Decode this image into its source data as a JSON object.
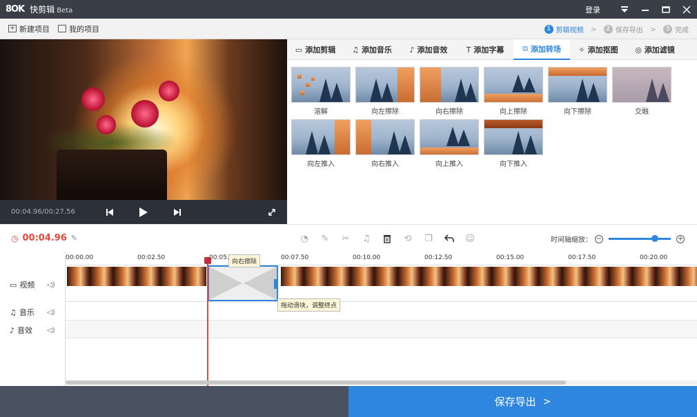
{
  "window": {
    "logo": "8OK",
    "app_name": "快剪辑",
    "beta": "Beta",
    "login": "登录",
    "icons": [
      "menu-icon",
      "minimize-icon",
      "maximize-icon",
      "close-icon"
    ]
  },
  "toolbar": {
    "new_project": "新建项目",
    "my_projects": "我的项目",
    "steps": [
      {
        "num": "1",
        "label": "剪辑视频"
      },
      {
        "num": "2",
        "label": "保存导出"
      },
      {
        "num": "3",
        "label": "完成"
      }
    ],
    "active_step": 0
  },
  "preview": {
    "timecode": "00:04.96/00:27.56",
    "icons": [
      "prev-frame-icon",
      "play-icon",
      "next-frame-icon",
      "fullscreen-icon"
    ]
  },
  "tabs": [
    {
      "label": "添加剪辑",
      "icon": "video-icon"
    },
    {
      "label": "添加音乐",
      "icon": "music-icon"
    },
    {
      "label": "添加音效",
      "icon": "sound-effect-icon"
    },
    {
      "label": "添加字幕",
      "icon": "text-icon"
    },
    {
      "label": "添加转场",
      "icon": "transition-icon"
    },
    {
      "label": "添加抠图",
      "icon": "cutout-icon"
    },
    {
      "label": "添加滤镜",
      "icon": "filter-icon"
    }
  ],
  "active_tab": 4,
  "transitions": [
    {
      "label": "溶解"
    },
    {
      "label": "向左擦除"
    },
    {
      "label": "向右擦除"
    },
    {
      "label": "向上擦除"
    },
    {
      "label": "向下擦除"
    },
    {
      "label": "交融"
    },
    {
      "label": "向左推入"
    },
    {
      "label": "向右推入"
    },
    {
      "label": "向上推入"
    },
    {
      "label": "向下推入"
    }
  ],
  "timeline": {
    "current_time": "00:04.96",
    "zoom_label": "时间轴缩放：",
    "zoom_level": 0.7,
    "tools": [
      "speed-icon",
      "pencil-icon",
      "scissors-icon",
      "bell-icon",
      "delete-icon",
      "crop-icon",
      "copy-icon",
      "undo-icon",
      "emoji-icon"
    ],
    "ruler": [
      "00:00.00",
      "00:02.50",
      "00:05.00",
      "00:07.50",
      "00:10.00",
      "00:12.50",
      "00:15.00",
      "00:17.50",
      "00:20.00"
    ],
    "tracks": [
      {
        "label": "视频",
        "icon": "video-icon"
      },
      {
        "label": "音乐",
        "icon": "music-icon"
      },
      {
        "label": "音效",
        "icon": "sound-effect-icon"
      }
    ],
    "transition_tooltip": "向右擦除",
    "handle_tooltip": "拖动滑块，调整终点"
  },
  "footer": {
    "export_label": "保存导出"
  },
  "colors": {
    "accent": "#2e86de",
    "playhead": "#e0483e",
    "titlebar": "#3a3f47",
    "footer": "#4a5160"
  }
}
